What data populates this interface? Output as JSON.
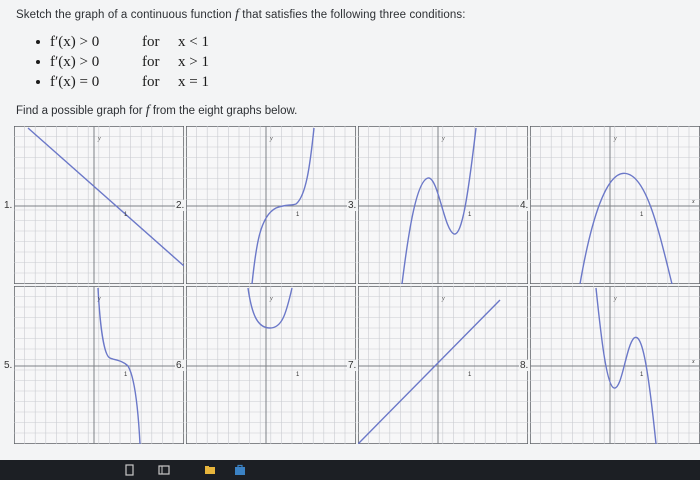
{
  "intro": {
    "before": "Sketch the graph of a continuous function ",
    "fvar": "f",
    "after": " that satisfies the following three conditions:"
  },
  "conditions": [
    {
      "expr": "f′(x) > 0",
      "word": "for",
      "domain": "x < 1"
    },
    {
      "expr": "f′(x) > 0",
      "word": "for",
      "domain": "x > 1"
    },
    {
      "expr": "f′(x) = 0",
      "word": "for",
      "domain": "x = 1"
    }
  ],
  "find": {
    "before": "Find a possible graph for ",
    "fvar": "f",
    "after": " from the eight graphs below."
  },
  "graphs": [
    {
      "number": "1.",
      "y_label": "y",
      "x_label": "x",
      "tick": "1",
      "curve": "decreasing line"
    },
    {
      "number": "2.",
      "y_label": "y",
      "x_label": "x",
      "tick": "1",
      "curve": "increasing with flat inflection at x = 1"
    },
    {
      "number": "3.",
      "y_label": "y",
      "x_label": "x",
      "tick": "1",
      "curve": "local max then local min at x = 1"
    },
    {
      "number": "4.",
      "y_label": "y",
      "x_label": "x",
      "tick": "1",
      "curve": "local max at x = 1"
    },
    {
      "number": "5.",
      "y_label": "y",
      "x_label": "x",
      "tick": "1",
      "curve": "decreasing with flat inflection at x = 1"
    },
    {
      "number": "6.",
      "y_label": "y",
      "x_label": "x",
      "tick": "1",
      "curve": "local min at x = 1"
    },
    {
      "number": "7.",
      "y_label": "y",
      "x_label": "x",
      "tick": "1",
      "curve": "increasing line"
    },
    {
      "number": "8.",
      "y_label": "y",
      "x_label": "x",
      "tick": "1",
      "curve": "local min then local max"
    }
  ],
  "colors": {
    "curve": "#6b78c8",
    "grid": "#c9cbd0",
    "frame": "#5d6066"
  },
  "taskbar_icons": [
    "file-explorer-icon",
    "window-icon",
    "folder-icon",
    "store-icon"
  ]
}
